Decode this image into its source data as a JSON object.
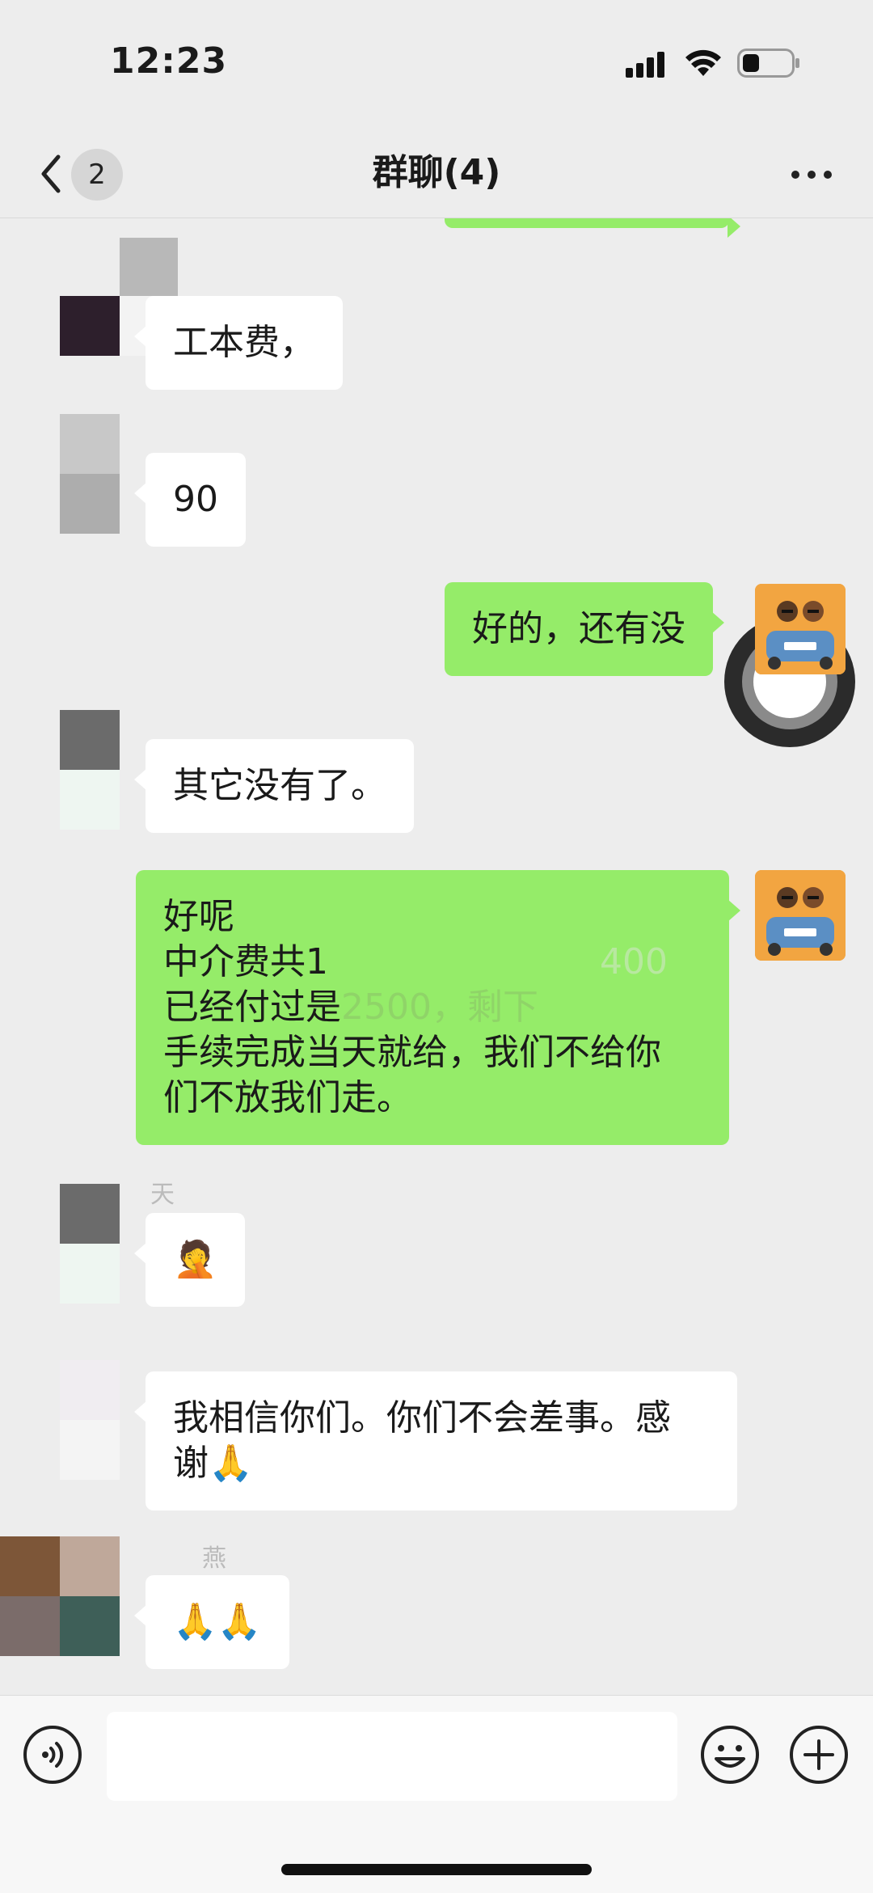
{
  "status_bar": {
    "time": "12:23"
  },
  "nav": {
    "back_count": "2",
    "title": "群聊(4)"
  },
  "messages": [
    {
      "side": "in",
      "text": "工本费，"
    },
    {
      "side": "in",
      "text": "90"
    },
    {
      "side": "out",
      "text": "好的，还有没"
    },
    {
      "side": "in",
      "text": "其它没有了。"
    },
    {
      "side": "out",
      "lines": [
        "好呢",
        "中介费共1",
        "已经付过是",
        "手续完成当天就给，我们不给你",
        "们不放我们走。"
      ]
    },
    {
      "side": "in",
      "emoji": "🤦"
    },
    {
      "side": "in",
      "lines": [
        "我相信你们。你们不会差事。感",
        "谢🙏"
      ]
    },
    {
      "side": "in",
      "emoji": "🙏🙏"
    }
  ],
  "fragments": {
    "amount_a": "400",
    "amount_b": "2500，剩下",
    "sender_a": "天",
    "sender_b": "燕"
  },
  "colors": {
    "outgoing_bubble": "#95ec69",
    "incoming_bubble": "#ffffff",
    "background": "#ededed"
  },
  "icons": [
    "back-chevron-icon",
    "more-icon",
    "voice-icon",
    "emoji-icon",
    "plus-icon",
    "signal-icon",
    "wifi-icon",
    "battery-icon"
  ]
}
